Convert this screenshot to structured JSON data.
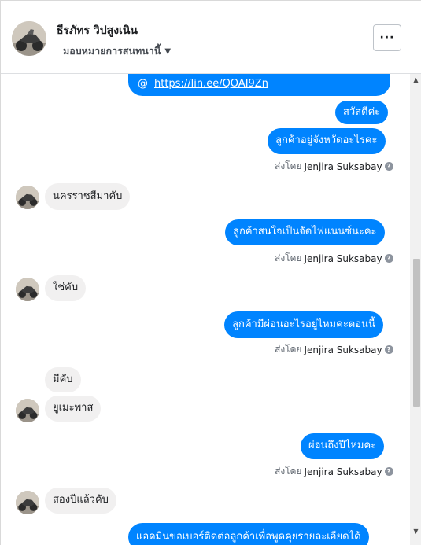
{
  "header": {
    "name": "ธีรภัทร วิปสูงเนิน",
    "assign_label": "มอบหมายการสนทนานี้",
    "assign_caret": "▼",
    "more_label": "···"
  },
  "thread": {
    "link": {
      "at": "@",
      "url": "https://lin.ee/QOAI9Zn"
    },
    "sent_by_prefix": "ส่งโดย",
    "agent": "Jenjira Suksabay",
    "help_glyph": "?",
    "messages": [
      {
        "dir": "out",
        "text": "สวัสดีค่ะ"
      },
      {
        "dir": "out",
        "text": "ลูกค้าอยู่จังหวัดอะไรคะ"
      },
      {
        "dir": "in",
        "text": "นครราชสีมาคับ"
      },
      {
        "dir": "out",
        "text": "ลูกค้าสนใจเป็นจัดไฟแนนซ์นะคะ"
      },
      {
        "dir": "in",
        "text": "ใช่คับ"
      },
      {
        "dir": "out",
        "text": "ลูกค้ามีผ่อนอะไรอยู่ไหมคะตอนนี้"
      },
      {
        "dir": "in",
        "text": "มีคับ"
      },
      {
        "dir": "in",
        "text": "ยูเมะพาส"
      },
      {
        "dir": "out",
        "text": "ผ่อนถึงปีไหมคะ"
      },
      {
        "dir": "in",
        "text": "สองปีแล้วคับ"
      },
      {
        "dir": "out",
        "text": "แอดมินขอเบอร์ติดต่อลูกค้าเพื่อพูดคุยรายละเอียดได้"
      }
    ]
  },
  "scrollbar": {
    "up": "▲",
    "down": "▼"
  }
}
